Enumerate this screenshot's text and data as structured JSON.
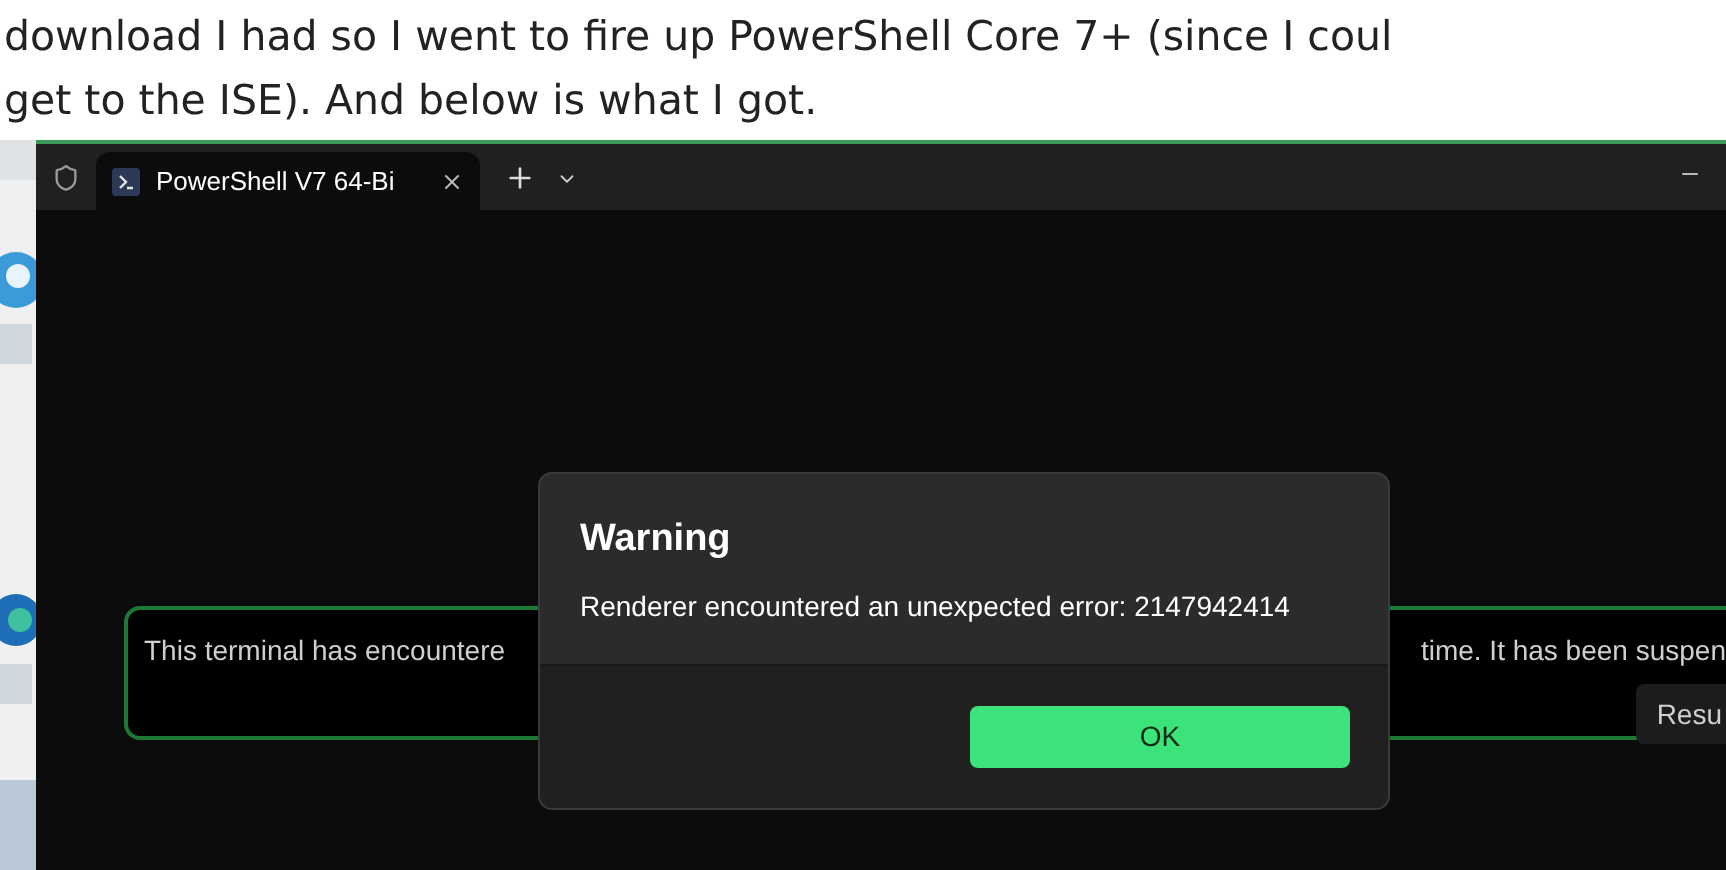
{
  "article": {
    "lines": [
      "download I had so I went to fire up PowerShell Core 7+ (since I coul",
      "get to the ISE). And below is what I got."
    ]
  },
  "terminal": {
    "tabs": [
      {
        "title": "PowerShell V7 64-Bi",
        "selected": true
      }
    ],
    "infobar": {
      "message_start": "This terminal has encountere",
      "message_end": "time. It has been suspen",
      "button": "Resu"
    }
  },
  "dialog": {
    "title": "Warning",
    "message": "Renderer encountered an unexpected error: 2147942414",
    "buttons": [
      "OK"
    ]
  }
}
